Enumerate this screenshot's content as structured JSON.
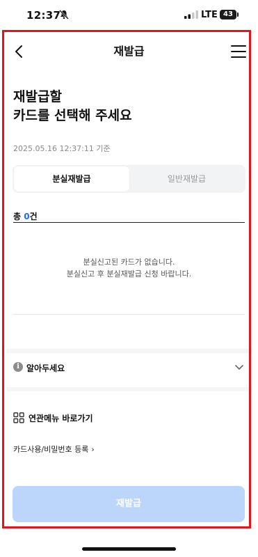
{
  "status_bar": {
    "time": "12:37",
    "network": "LTE",
    "battery": "43",
    "icons": [
      "bell-mute-icon",
      "signal-icon"
    ]
  },
  "header": {
    "title": "재발급",
    "back_icon": "chevron-left-icon",
    "menu_icon": "hamburger-menu-icon"
  },
  "main": {
    "headline_line1": "재발급할",
    "headline_line2": "카드를 선택해 주세요",
    "timestamp": "2025.05.16 12:37:11 기준",
    "tabs": [
      {
        "label": "분실재발급",
        "active": true
      },
      {
        "label": "일반재발급",
        "active": false
      }
    ],
    "count_prefix": "총 ",
    "count_value": "0",
    "count_suffix": "건",
    "empty_line1": "분실신고된 카드가 없습니다.",
    "empty_line2": "분실신고 후 분실재발급 신청 바랍니다."
  },
  "notice": {
    "label": "알아두세요",
    "icon": "info-icon"
  },
  "related": {
    "label": "연관메뉴 바로가기",
    "icon": "grid-icon",
    "links": [
      {
        "label": "카드사용/비밀번호 등록"
      }
    ]
  },
  "footer": {
    "button_label": "재발급"
  },
  "colors": {
    "accent_blue": "#1e6cf0",
    "disabled_button": "#bcd5fb",
    "highlight_frame": "#e3151a"
  }
}
